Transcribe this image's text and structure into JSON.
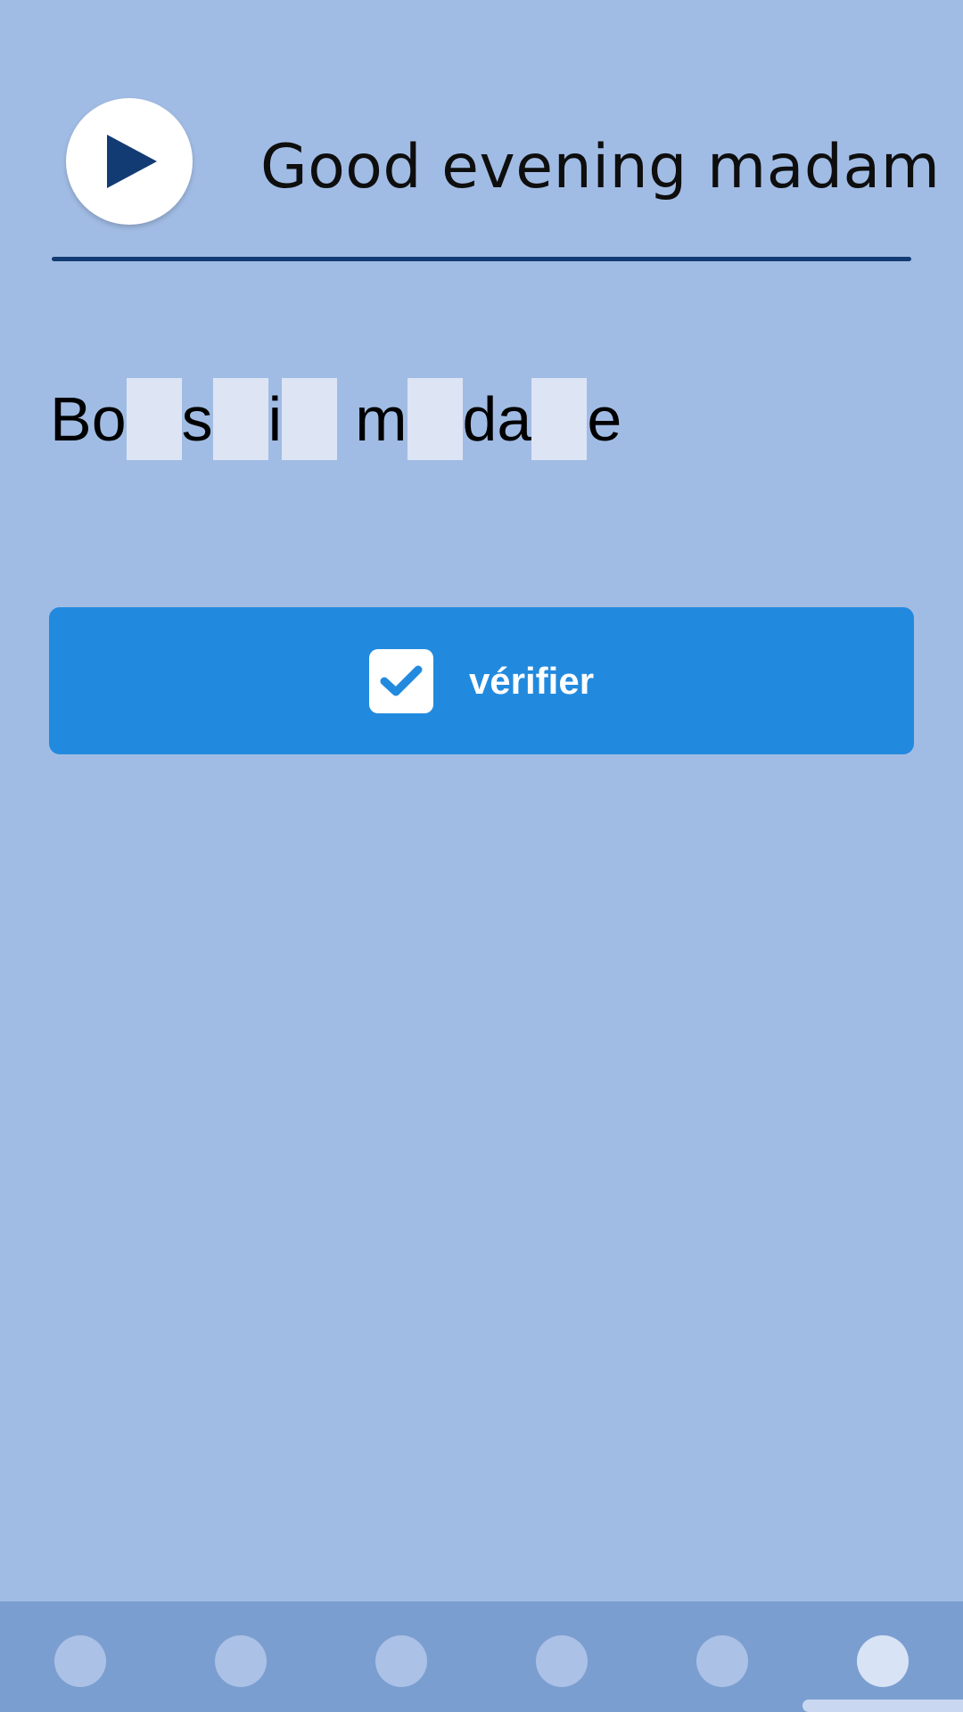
{
  "header": {
    "play_icon": "play-icon",
    "prompt_text": "Good evening madam"
  },
  "exercise": {
    "fragments": [
      "Bo",
      "s",
      "i",
      "m",
      "da",
      "e"
    ]
  },
  "verify_button": {
    "icon": "checkbox-checked-icon",
    "label": "vérifier"
  },
  "progress": {
    "total_steps": 6,
    "current_step": 6
  },
  "colors": {
    "background": "#a1bce4",
    "accent": "#228ade",
    "divider": "#123b73",
    "play_icon": "#123b73",
    "bottom_bar": "#7b9ed0"
  }
}
